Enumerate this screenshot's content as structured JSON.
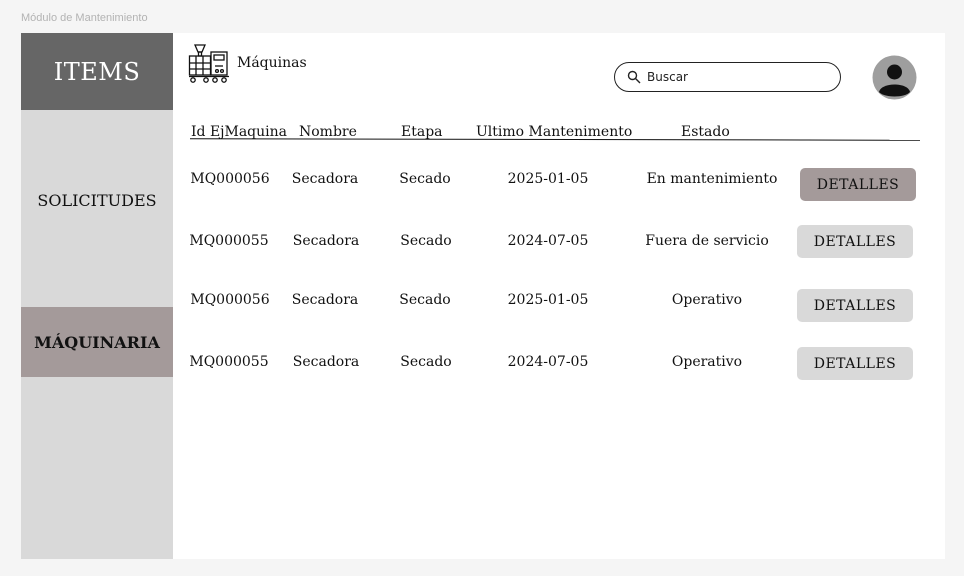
{
  "window": {
    "frame_label": "Módulo de Mantenimiento"
  },
  "sidebar": {
    "brand": "ITEMS",
    "items": [
      {
        "label": "SOLICITUDES",
        "active": false
      },
      {
        "label": "MÁQUINARIA",
        "active": true
      }
    ]
  },
  "header": {
    "title": "Máquinas",
    "icon": "machine-icon",
    "search": {
      "placeholder": "Buscar",
      "value": ""
    },
    "avatar": "user-avatar-icon"
  },
  "table": {
    "columns": [
      "Id EjMaquina",
      "Nombre",
      "Etapa",
      "Ultimo Mantenimento",
      "Estado"
    ],
    "rows": [
      {
        "id": "MQ000056",
        "nombre": "Secadora",
        "etapa": "Secado",
        "ultimo": "2025-01-05",
        "estado": "En mantenimiento",
        "action": "DETALLES"
      },
      {
        "id": "MQ000055",
        "nombre": "Secadora",
        "etapa": "Secado",
        "ultimo": "2024-07-05",
        "estado": "Fuera de servicio",
        "action": "DETALLES"
      },
      {
        "id": "MQ000056",
        "nombre": "Secadora",
        "etapa": "Secado",
        "ultimo": "2025-01-05",
        "estado": "Operativo",
        "action": "DETALLES"
      },
      {
        "id": "MQ000055",
        "nombre": "Secadora",
        "etapa": "Secado",
        "ultimo": "2024-07-05",
        "estado": "Operativo",
        "action": "DETALLES"
      }
    ]
  },
  "colors": {
    "brand_bg": "#666666",
    "sidebar_bg": "#d9d9d9",
    "active_bg": "#a49a9a",
    "button_bg": "#d9d9d9"
  }
}
